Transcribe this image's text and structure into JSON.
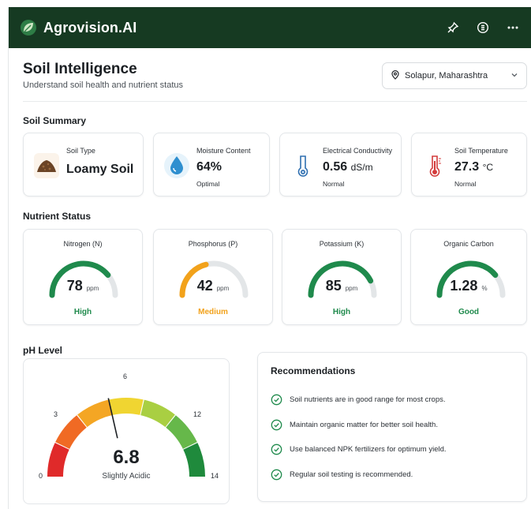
{
  "app": {
    "name": "Agrovision.AI"
  },
  "header_icons": [
    "pin-icon",
    "settings-icon",
    "more-icon"
  ],
  "page": {
    "title": "Soil Intelligence",
    "subtitle": "Understand soil health and nutrient status",
    "location": "Solapur, Maharashtra"
  },
  "soil_summary": {
    "title": "Soil Summary",
    "cards": [
      {
        "label": "Soil Type",
        "value": "Loamy Soil",
        "unit": "",
        "note": "",
        "icon": "soil-icon"
      },
      {
        "label": "Moisture Content",
        "value": "64%",
        "unit": "",
        "note": "Optimal",
        "icon": "water-drop-icon"
      },
      {
        "label": "Electrical Conductivity",
        "value": "0.56",
        "unit": "dS/m",
        "note": "Normal",
        "icon": "conductivity-icon"
      },
      {
        "label": "Soil Temperature",
        "value": "27.3",
        "unit": "°C",
        "note": "Normal",
        "icon": "thermometer-icon"
      }
    ]
  },
  "nutrient_status": {
    "title": "Nutrient Status",
    "cards": [
      {
        "label": "Nitrogen (N)",
        "value": "78",
        "unit": "ppm",
        "status": "High",
        "level": 0.78,
        "color": "#1f8a4c"
      },
      {
        "label": "Phosphorus (P)",
        "value": "42",
        "unit": "ppm",
        "status": "Medium",
        "level": 0.42,
        "color": "#f2a21b"
      },
      {
        "label": "Potassium (K)",
        "value": "85",
        "unit": "ppm",
        "status": "High",
        "level": 0.85,
        "color": "#1f8a4c"
      },
      {
        "label": "Organic Carbon",
        "value": "1.28",
        "unit": "%",
        "status": "Good",
        "level": 0.78,
        "color": "#1f8a4c"
      }
    ]
  },
  "ph": {
    "title": "pH Level",
    "value": "6.8",
    "description": "Slightly Acidic",
    "ticks": [
      "0",
      "3",
      "6",
      "12",
      "14"
    ],
    "scale_max": 14,
    "needle_value": 6,
    "segment_colors": [
      "#e02a2a",
      "#f06a24",
      "#f4a624",
      "#f0d531",
      "#a9cf42",
      "#66b84a",
      "#1f8a3c"
    ]
  },
  "recommendations": {
    "title": "Recommendations",
    "items": [
      "Soil nutrients are in good range for most crops.",
      "Maintain organic matter for better soil health.",
      "Use balanced NPK fertilizers for optimum yield.",
      "Regular soil testing is recommended."
    ]
  },
  "colors": {
    "header_bg": "#163a22",
    "good": "#1f8a4c",
    "medium": "#f2a21b",
    "track": "#e3e6e8"
  }
}
